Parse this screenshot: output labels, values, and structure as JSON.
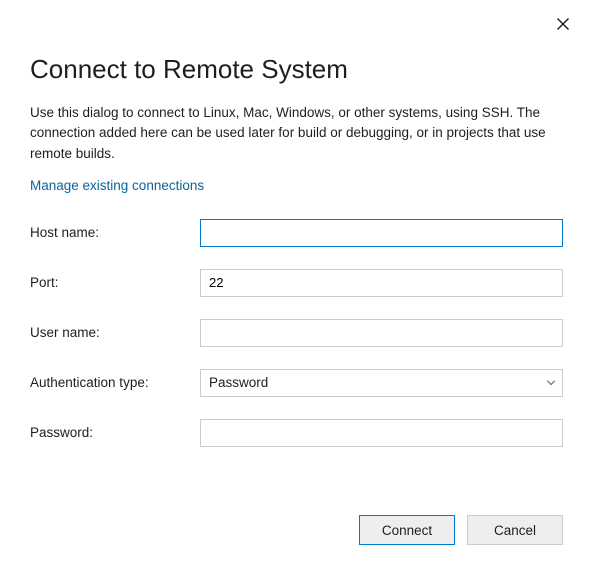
{
  "dialog": {
    "title": "Connect to Remote System",
    "description": "Use this dialog to connect to Linux, Mac, Windows, or other systems, using SSH. The connection added here can be used later for build or debugging, or in projects that use remote builds.",
    "manage_link": "Manage existing connections"
  },
  "form": {
    "host_name": {
      "label": "Host name:",
      "value": ""
    },
    "port": {
      "label": "Port:",
      "value": "22"
    },
    "user_name": {
      "label": "User name:",
      "value": ""
    },
    "auth_type": {
      "label": "Authentication type:",
      "value": "Password"
    },
    "password": {
      "label": "Password:",
      "value": ""
    }
  },
  "buttons": {
    "connect": "Connect",
    "cancel": "Cancel"
  }
}
